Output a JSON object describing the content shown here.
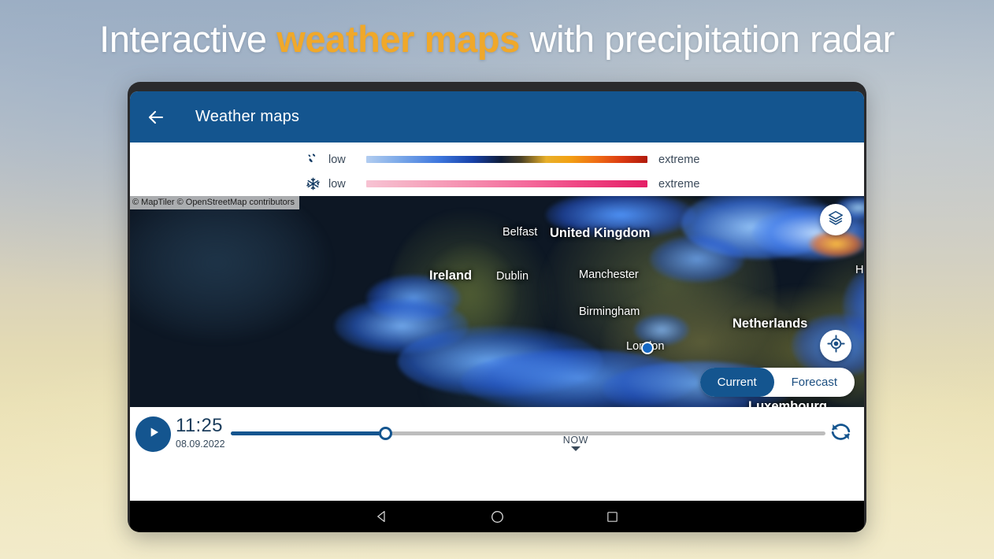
{
  "headline": {
    "part1": "Interactive ",
    "accent": "weather maps",
    "part2": " with precipitation radar"
  },
  "appbar": {
    "back_icon": "arrow-left-icon",
    "title": "Weather maps",
    "background_color": "#14558f"
  },
  "legend": {
    "rows": [
      {
        "icon": "rain-drops-icon",
        "low_label": "low",
        "extreme_label": "extreme",
        "gradient": "light-blue-to-dark-red"
      },
      {
        "icon": "snowflake-icon",
        "low_label": "low",
        "extreme_label": "extreme",
        "gradient": "light-pink-to-crimson"
      }
    ]
  },
  "map": {
    "attribution": "© MapTiler © OpenStreetMap contributors",
    "labels": [
      {
        "text": "Belfast",
        "type": "city"
      },
      {
        "text": "United Kingdom",
        "type": "country"
      },
      {
        "text": "Ireland",
        "type": "country"
      },
      {
        "text": "Dublin",
        "type": "city"
      },
      {
        "text": "Manchester",
        "type": "city"
      },
      {
        "text": "Birmingham",
        "type": "city"
      },
      {
        "text": "Netherlands",
        "type": "country"
      },
      {
        "text": "London",
        "type": "city"
      },
      {
        "text": "Luxembourg",
        "type": "country"
      },
      {
        "text": "H",
        "type": "city"
      }
    ],
    "layers_icon": "layers-stack-icon",
    "locate_icon": "crosshair-locate-icon",
    "location_marker": "current-location-marker"
  },
  "mode_toggle": {
    "current_label": "Current",
    "forecast_label": "Forecast",
    "selected": "Current",
    "accent_color": "#14558f"
  },
  "timeline": {
    "play_icon": "play-icon",
    "time": "11:25",
    "date": "08.09.2022",
    "now_label": "NOW",
    "slider_percent": 26,
    "now_marker_percent": 58,
    "refresh_icon": "refresh-icon"
  },
  "navbar": {
    "back_icon": "nav-back-triangle-icon",
    "home_icon": "nav-home-circle-icon",
    "recents_icon": "nav-recents-square-icon"
  }
}
